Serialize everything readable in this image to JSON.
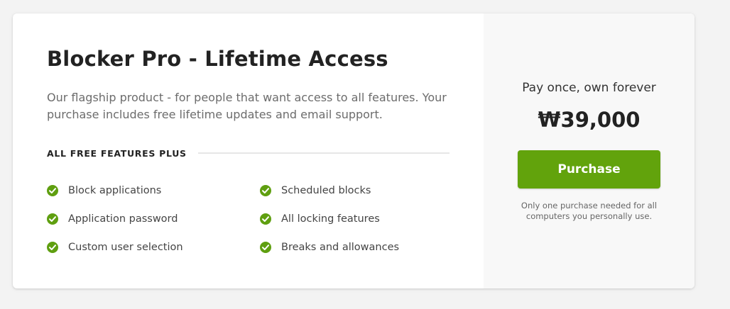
{
  "product": {
    "title": "Blocker Pro - Lifetime Access",
    "description": "Our flagship product - for people that want access to all features. Your purchase includes free lifetime updates and email support."
  },
  "features": {
    "heading": "ALL FREE FEATURES PLUS",
    "icon": "check-circle-icon",
    "check_color": "#5f9f10",
    "items": [
      {
        "label": "Block applications"
      },
      {
        "label": "Application password"
      },
      {
        "label": "Custom user selection"
      },
      {
        "label": "Scheduled blocks"
      },
      {
        "label": "All locking features"
      },
      {
        "label": "Breaks and allowances"
      }
    ]
  },
  "pricing": {
    "tagline": "Pay once, own forever",
    "price": "₩39,000",
    "button_label": "Purchase",
    "button_color": "#62a30c",
    "note": "Only one purchase needed for all computers you personally use."
  }
}
